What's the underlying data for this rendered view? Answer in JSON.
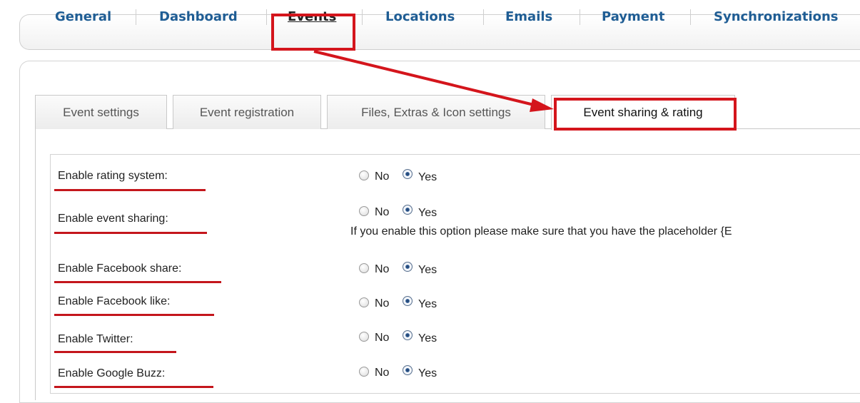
{
  "topnav": {
    "items": [
      "General",
      "Dashboard",
      "Events",
      "Locations",
      "Emails",
      "Payment",
      "Synchronizations"
    ],
    "active": "Events"
  },
  "subtabs": {
    "items": [
      "Event settings",
      "Event registration",
      "Files, Extras & Icon settings",
      "Event sharing & rating"
    ],
    "active": "Event sharing & rating"
  },
  "settings": [
    {
      "label": "Enable rating system:",
      "no": "No",
      "yes": "Yes",
      "value": "Yes"
    },
    {
      "label": "Enable event sharing:",
      "no": "No",
      "yes": "Yes",
      "value": "Yes",
      "hint": "If you enable this option please make sure that you have the placeholder {E"
    },
    {
      "label": "Enable Facebook share:",
      "no": "No",
      "yes": "Yes",
      "value": "Yes"
    },
    {
      "label": "Enable Facebook like:",
      "no": "No",
      "yes": "Yes",
      "value": "Yes"
    },
    {
      "label": "Enable Twitter:",
      "no": "No",
      "yes": "Yes",
      "value": "Yes"
    },
    {
      "label": "Enable Google Buzz:",
      "no": "No",
      "yes": "Yes",
      "value": "Yes"
    }
  ],
  "colors": {
    "annotation": "#d4151c",
    "link": "#1f5d94"
  }
}
